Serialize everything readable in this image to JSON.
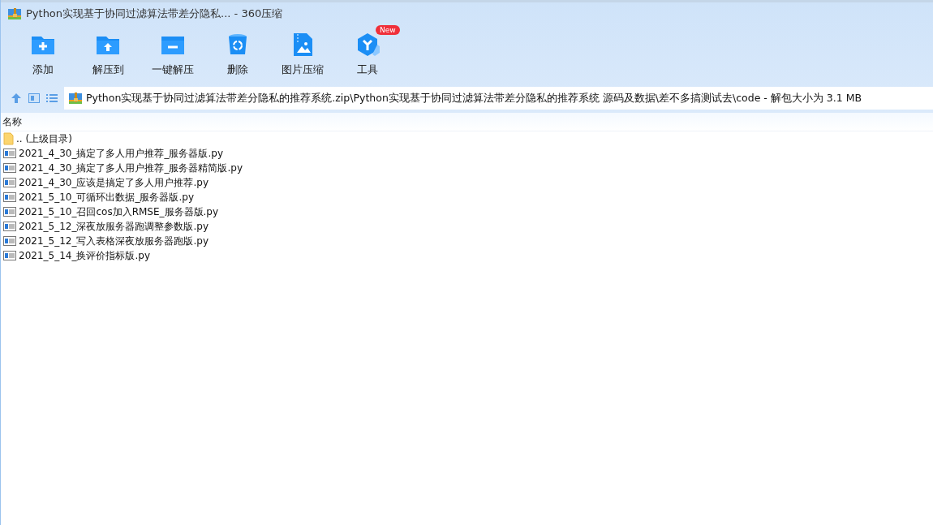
{
  "window": {
    "title": "Python实现基于协同过滤算法带差分隐私... - 360压缩"
  },
  "toolbar": [
    {
      "kind": "add",
      "label": "添加"
    },
    {
      "kind": "extract",
      "label": "解压到"
    },
    {
      "kind": "oneclick",
      "label": "一键解压"
    },
    {
      "kind": "delete",
      "label": "删除"
    },
    {
      "kind": "image",
      "label": "图片压缩"
    },
    {
      "kind": "tools",
      "label": "工具",
      "badge": "New"
    }
  ],
  "path_bar": {
    "path": "Python实现基于协同过滤算法带差分隐私的推荐系统.zip\\Python实现基于协同过滤算法带差分隐私的推荐系统 源码及数据\\差不多搞测试去\\code - 解包大小为 3.1 MB"
  },
  "file_list": {
    "columns": [
      "名称"
    ],
    "rows": [
      {
        "kind": "parent",
        "name": ".. (上级目录)"
      },
      {
        "kind": "file",
        "name": "2021_4_30_搞定了多人用户推荐_服务器版.py"
      },
      {
        "kind": "file",
        "name": "2021_4_30_搞定了多人用户推荐_服务器精简版.py"
      },
      {
        "kind": "file",
        "name": "2021_4_30_应该是搞定了多人用户推荐.py"
      },
      {
        "kind": "file",
        "name": "2021_5_10_可循环出数据_服务器版.py"
      },
      {
        "kind": "file",
        "name": "2021_5_10_召回cos加入RMSE_服务器版.py"
      },
      {
        "kind": "file",
        "name": "2021_5_12_深夜放服务器跑调整参数版.py"
      },
      {
        "kind": "file",
        "name": "2021_5_12_写入表格深夜放服务器跑版.py"
      },
      {
        "kind": "file",
        "name": "2021_5_14_换评价指标版.py"
      }
    ]
  }
}
